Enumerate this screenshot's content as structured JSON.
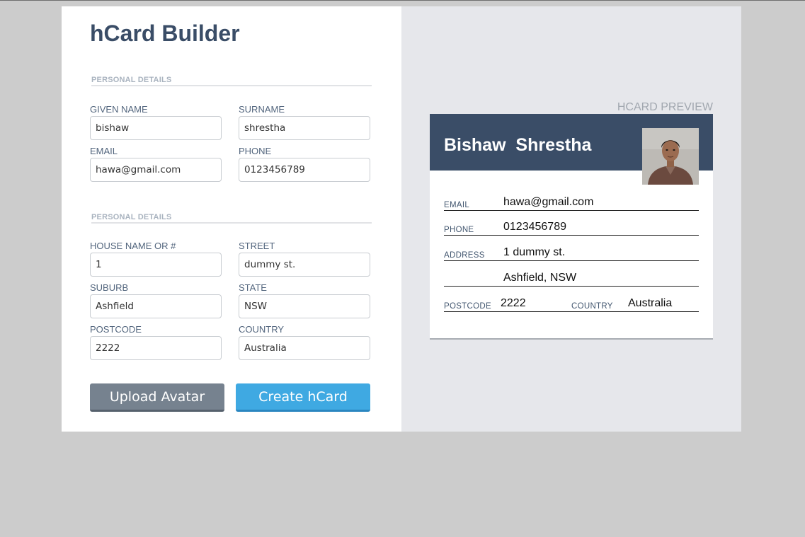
{
  "builder": {
    "title": "hCard Builder",
    "sections": [
      {
        "heading": "PERSONAL DETAILS"
      },
      {
        "heading": "PERSONAL DETAILS"
      }
    ],
    "fields": {
      "given_name": {
        "label": "GIVEN NAME",
        "value": "bishaw"
      },
      "surname": {
        "label": "SURNAME",
        "value": "shrestha"
      },
      "email": {
        "label": "EMAIL",
        "value": "hawa@gmail.com"
      },
      "phone": {
        "label": "PHONE",
        "value": "0123456789"
      },
      "house": {
        "label": "HOUSE NAME OR #",
        "value": "1"
      },
      "street": {
        "label": "STREET",
        "value": "dummy st."
      },
      "suburb": {
        "label": "SUBURB",
        "value": "Ashfield"
      },
      "state": {
        "label": "STATE",
        "value": "NSW"
      },
      "postcode": {
        "label": "POSTCODE",
        "value": "2222"
      },
      "country": {
        "label": "COUNTRY",
        "value": "Australia"
      }
    },
    "buttons": {
      "upload": "Upload Avatar",
      "create": "Create hCard"
    }
  },
  "preview": {
    "label": "HCARD PREVIEW",
    "card": {
      "name": "Bishaw  Shrestha",
      "avatar_icon": "person-photo",
      "email_label": "EMAIL",
      "email": "hawa@gmail.com",
      "phone_label": "PHONE",
      "phone": "0123456789",
      "address_label": "ADDRESS",
      "address_line1": "1 dummy st.",
      "address_line2": "Ashfield, NSW",
      "postcode_label": "POSTCODE",
      "postcode": "2222",
      "country_label": "COUNTRY",
      "country": "Australia"
    }
  },
  "colors": {
    "page_background": "#cccccc",
    "header_navy": "#3a4d67",
    "upload_button": "#76828f",
    "create_button": "#3fa9e2",
    "preview_background": "#e6e7eb"
  }
}
